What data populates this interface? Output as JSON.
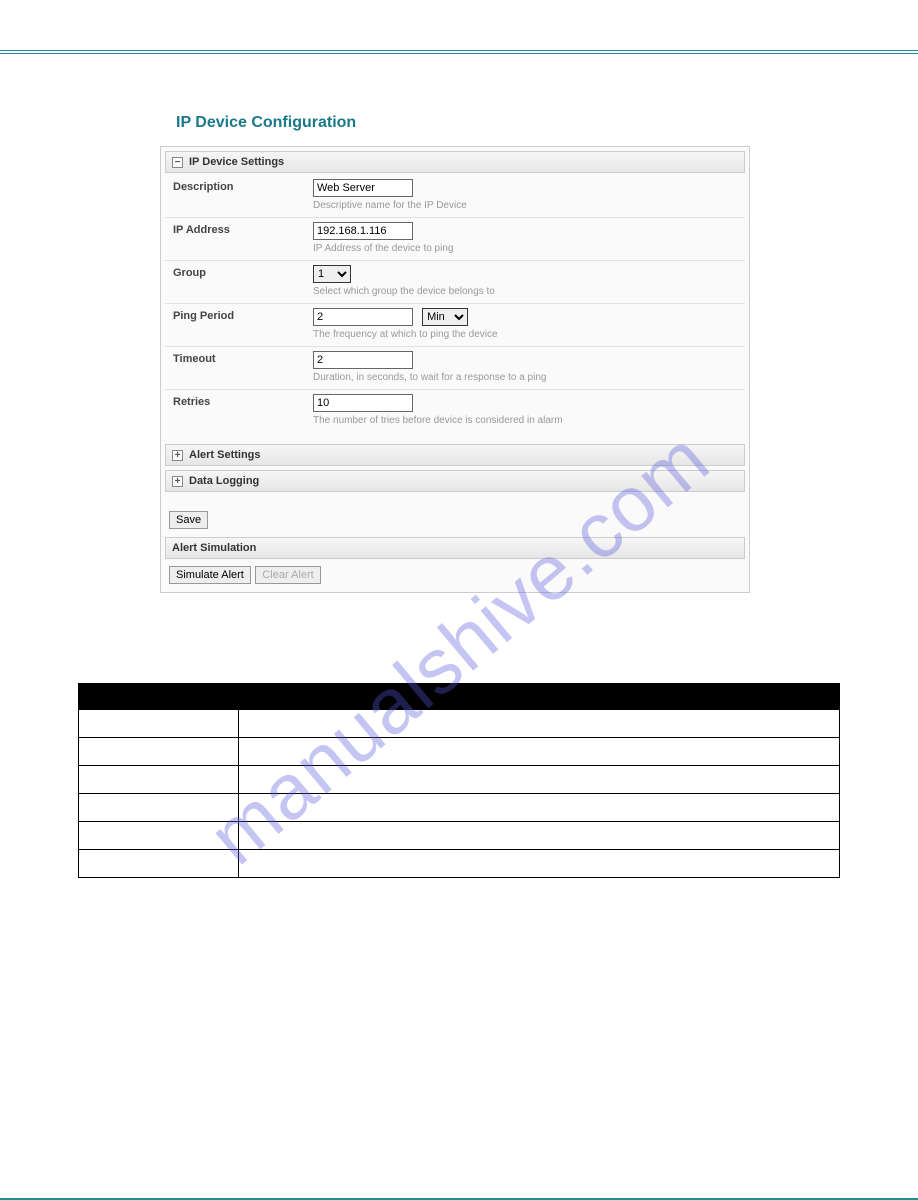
{
  "watermark": "manualshive.com",
  "title": "IP Device Configuration",
  "sections": {
    "ipDeviceSettings": {
      "header": "IP Device Settings",
      "toggle": "−",
      "rows": {
        "description": {
          "label": "Description",
          "value": "Web Server",
          "hint": "Descriptive name for the IP Device"
        },
        "ipAddress": {
          "label": "IP Address",
          "value": "192.168.1.116",
          "hint": "IP Address of the device to ping"
        },
        "group": {
          "label": "Group",
          "value": "1",
          "hint": "Select which group the device belongs to"
        },
        "pingPeriod": {
          "label": "Ping Period",
          "value": "2",
          "unit": "Min",
          "hint": "The frequency at which to ping the device"
        },
        "timeout": {
          "label": "Timeout",
          "value": "2",
          "hint": "Duration, in seconds, to wait for a response to a ping"
        },
        "retries": {
          "label": "Retries",
          "value": "10",
          "hint": "The number of tries before device is considered in alarm"
        }
      }
    },
    "alertSettings": {
      "header": "Alert Settings",
      "toggle": "+"
    },
    "dataLogging": {
      "header": "Data Logging",
      "toggle": "+"
    }
  },
  "buttons": {
    "save": "Save",
    "simulateAlert": "Simulate Alert",
    "clearAlert": "Clear Alert"
  },
  "alertSimulation": {
    "header": "Alert Simulation"
  }
}
